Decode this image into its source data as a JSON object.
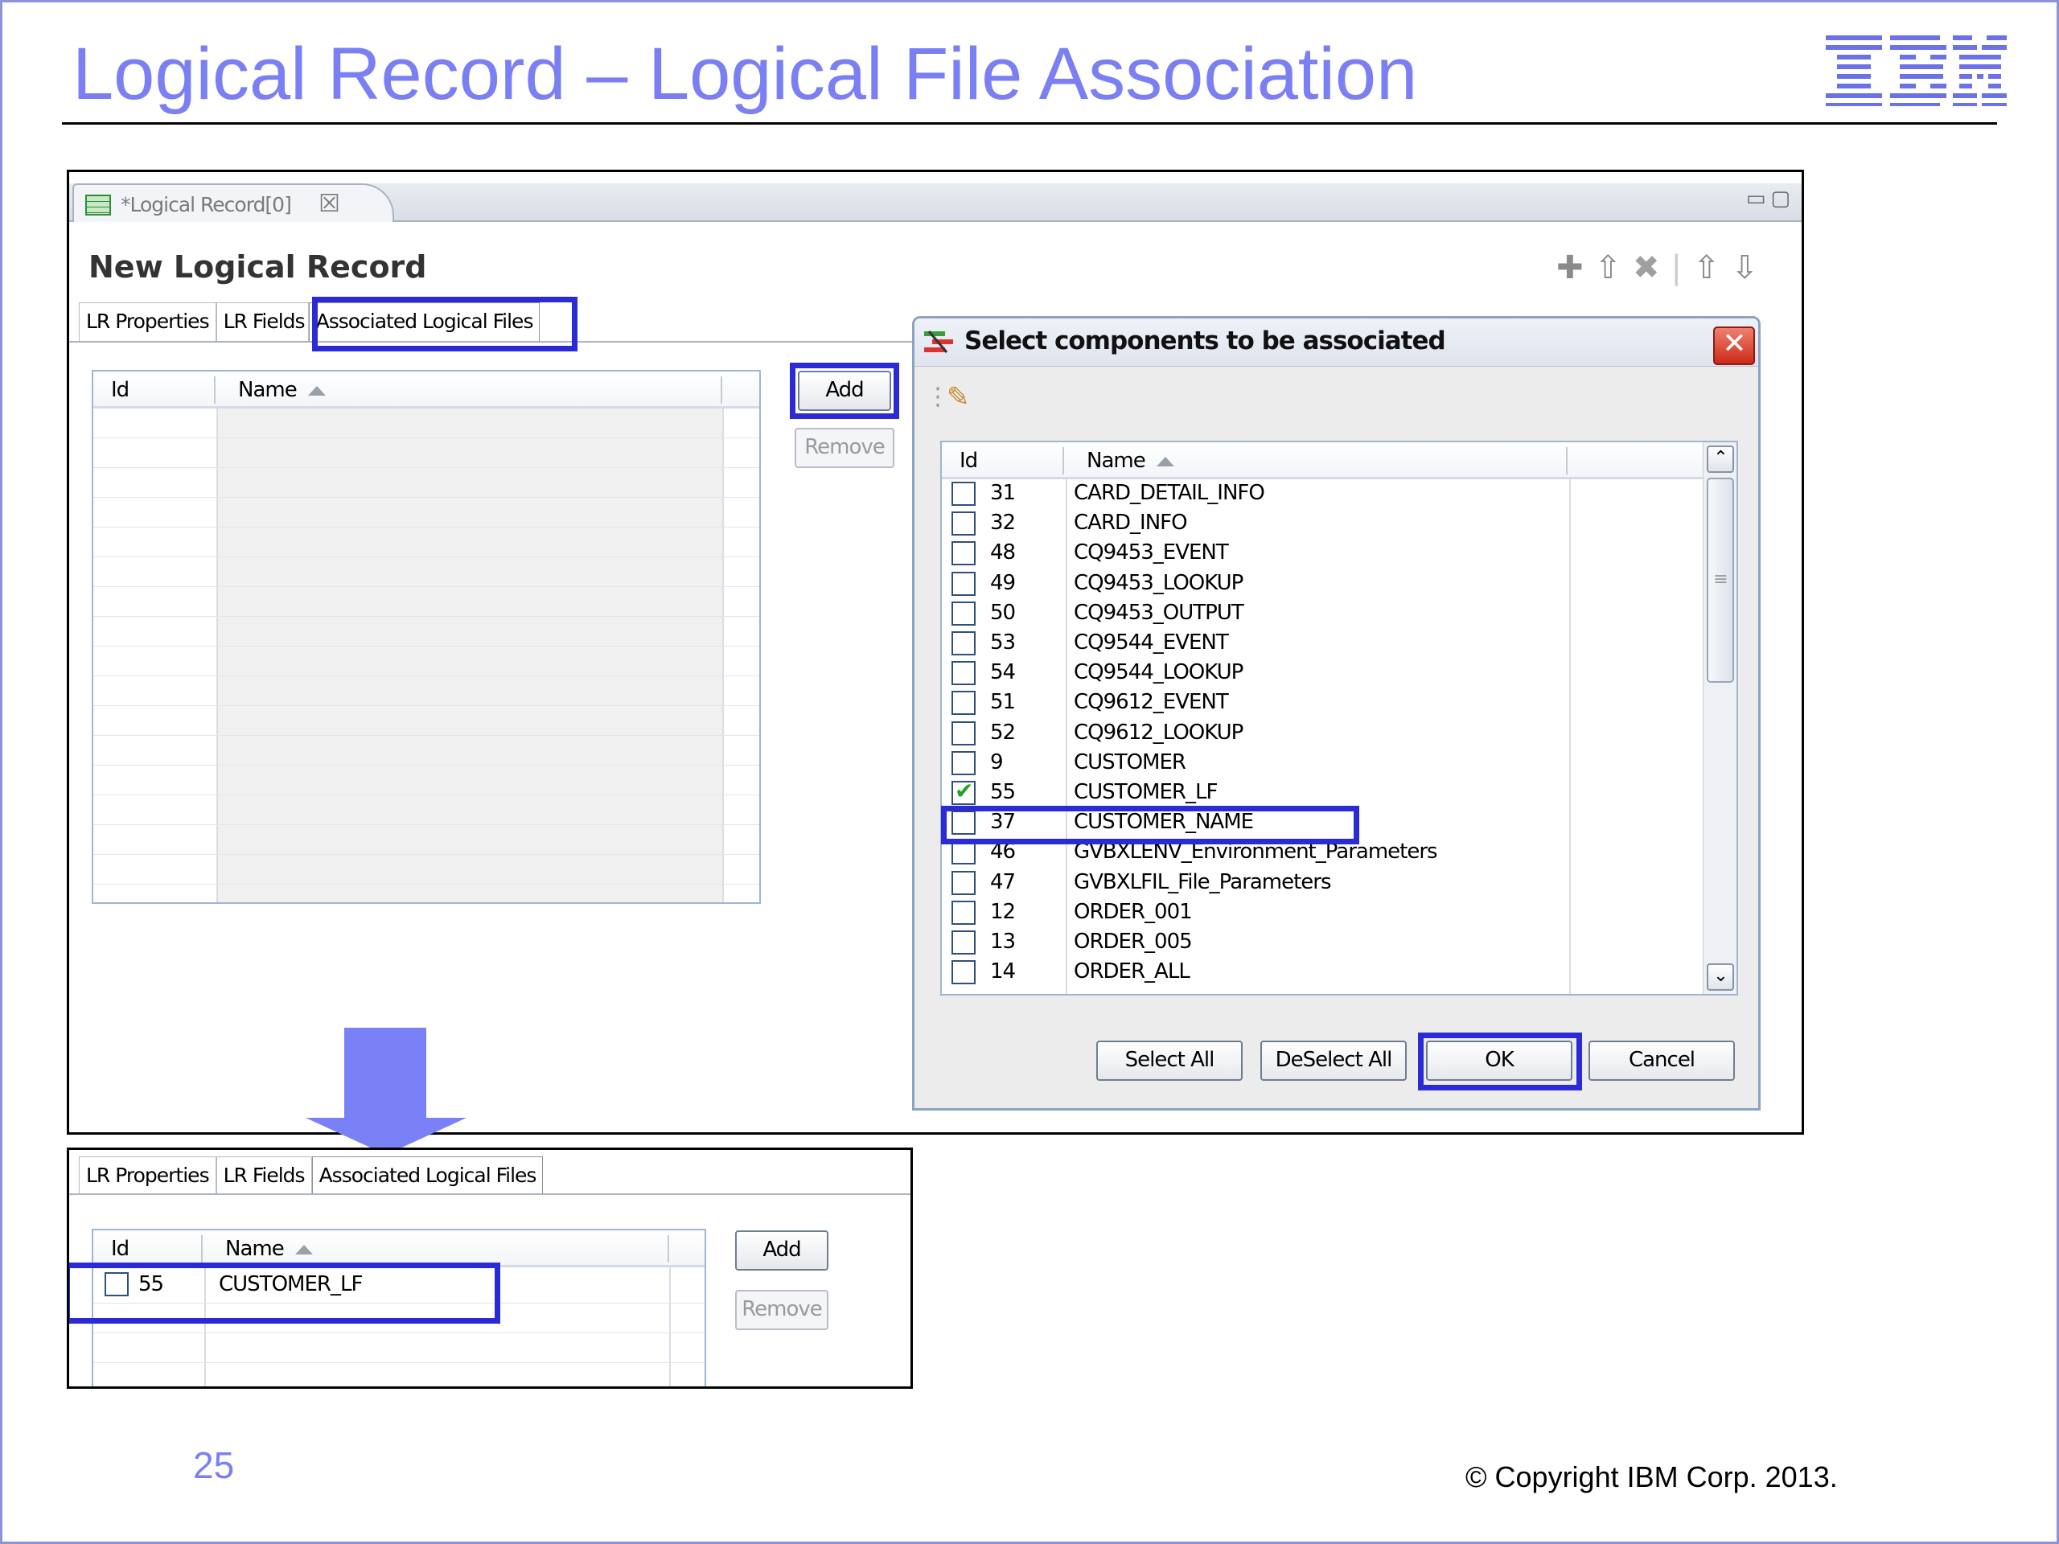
{
  "slide": {
    "title": "Logical Record – Logical File Association",
    "logo_text": "IBM",
    "page_number": "25",
    "copyright": "© Copyright IBM Corp. 2013."
  },
  "editor": {
    "tab_label": "*Logical Record[0]",
    "form_title": "New Logical Record",
    "subtabs": [
      "LR Properties",
      "LR Fields",
      "Associated Logical Files"
    ],
    "columns": [
      "Id",
      "Name"
    ],
    "add_label": "Add",
    "remove_label": "Remove",
    "toolbar_icons": [
      "plus-icon",
      "insert-up-icon",
      "delete-icon",
      "move-up-icon",
      "move-down-icon"
    ]
  },
  "dialog": {
    "title": "Select components to be associated",
    "columns": [
      "Id",
      "Name"
    ],
    "rows": [
      {
        "id": "31",
        "name": "CARD_DETAIL_INFO",
        "checked": false
      },
      {
        "id": "32",
        "name": "CARD_INFO",
        "checked": false
      },
      {
        "id": "48",
        "name": "CQ9453_EVENT",
        "checked": false
      },
      {
        "id": "49",
        "name": "CQ9453_LOOKUP",
        "checked": false
      },
      {
        "id": "50",
        "name": "CQ9453_OUTPUT",
        "checked": false
      },
      {
        "id": "53",
        "name": "CQ9544_EVENT",
        "checked": false
      },
      {
        "id": "54",
        "name": "CQ9544_LOOKUP",
        "checked": false
      },
      {
        "id": "51",
        "name": "CQ9612_EVENT",
        "checked": false
      },
      {
        "id": "52",
        "name": "CQ9612_LOOKUP",
        "checked": false
      },
      {
        "id": "9",
        "name": "CUSTOMER",
        "checked": false
      },
      {
        "id": "55",
        "name": "CUSTOMER_LF",
        "checked": true
      },
      {
        "id": "37",
        "name": "CUSTOMER_NAME",
        "checked": false
      },
      {
        "id": "46",
        "name": "GVBXLENV_Environment_Parameters",
        "checked": false
      },
      {
        "id": "47",
        "name": "GVBXLFIL_File_Parameters",
        "checked": false
      },
      {
        "id": "12",
        "name": "ORDER_001",
        "checked": false
      },
      {
        "id": "13",
        "name": "ORDER_005",
        "checked": false
      },
      {
        "id": "14",
        "name": "ORDER_ALL",
        "checked": false
      }
    ],
    "buttons": {
      "select_all": "Select All",
      "deselect_all": "DeSelect All",
      "ok": "OK",
      "cancel": "Cancel"
    }
  },
  "result": {
    "subtabs": [
      "LR Properties",
      "LR Fields",
      "Associated Logical Files"
    ],
    "columns": [
      "Id",
      "Name"
    ],
    "rows": [
      {
        "id": "55",
        "name": "CUSTOMER_LF",
        "checked": false
      }
    ],
    "add_label": "Add",
    "remove_label": "Remove"
  },
  "colors": {
    "title_blue": "#7a7ff4",
    "highlight_blue": "#2b2bd6",
    "arrow_blue": "#7a80f5"
  }
}
